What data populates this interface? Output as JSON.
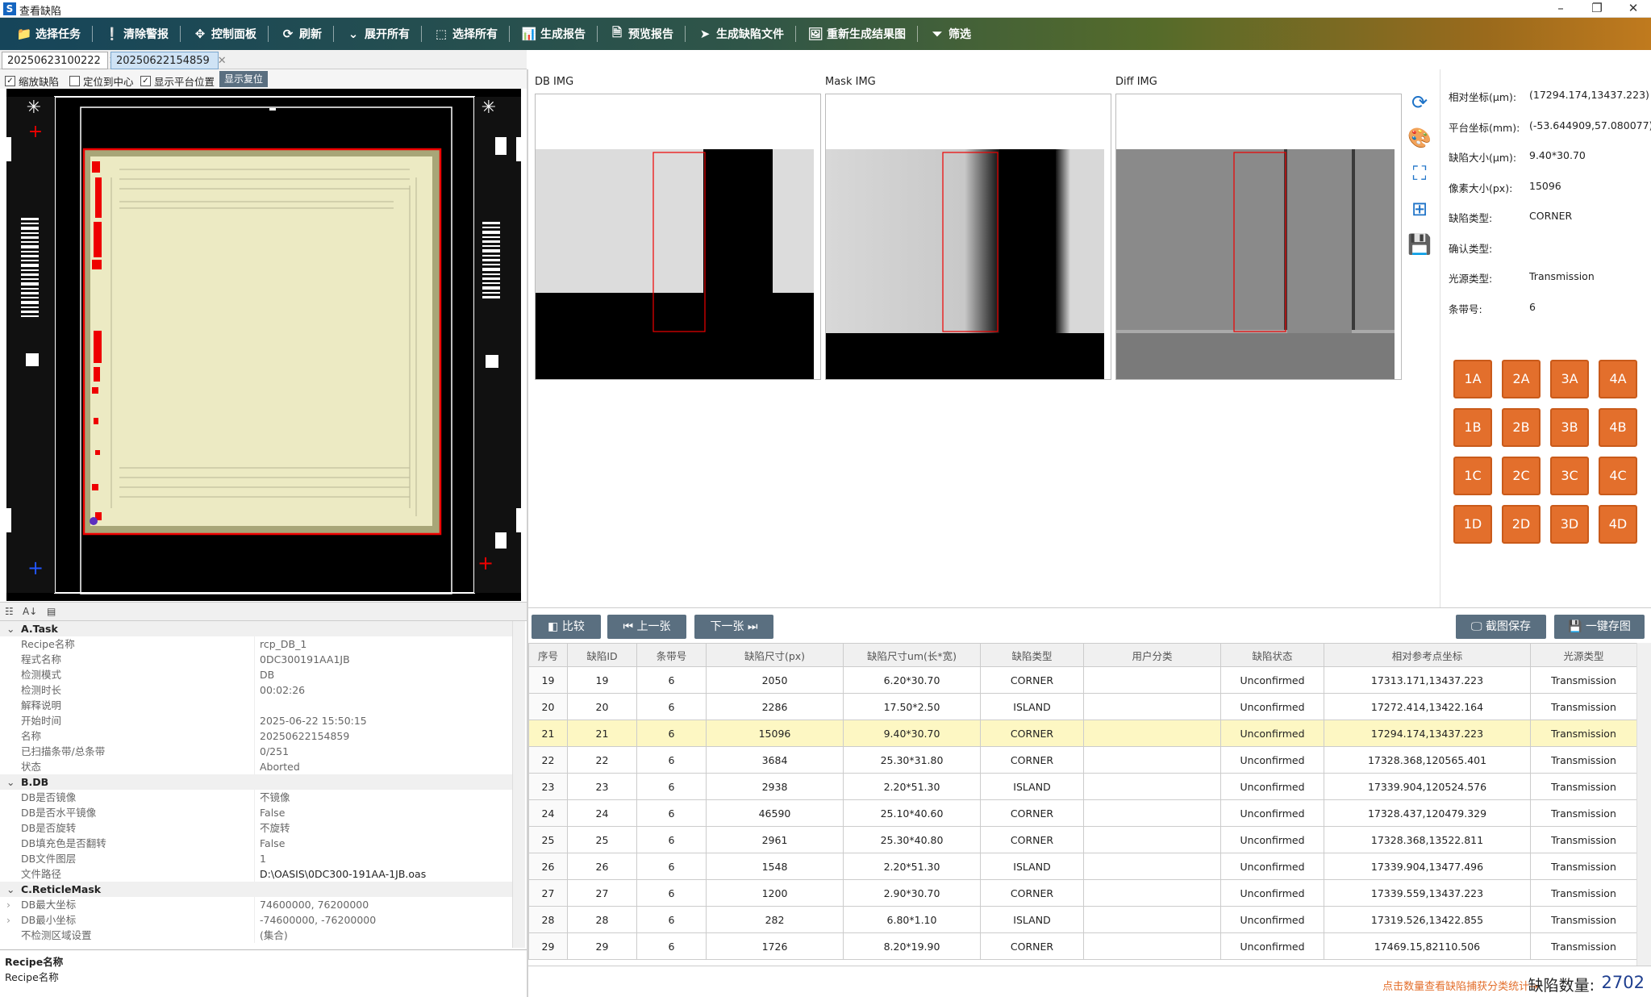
{
  "window": {
    "title": "查看缺陷",
    "app_icon": "S"
  },
  "toolbar": {
    "items": [
      {
        "label": "选择任务",
        "icon": "folder-icon"
      },
      {
        "label": "清除警报",
        "icon": "alert-icon"
      },
      {
        "label": "控制面板",
        "icon": "move-icon"
      },
      {
        "label": "刷新",
        "icon": "refresh-icon"
      },
      {
        "label": "展开所有",
        "icon": "chevron-down-icon"
      },
      {
        "label": "选择所有",
        "icon": "select-all-icon"
      },
      {
        "label": "生成报告",
        "icon": "report-icon"
      },
      {
        "label": "预览报告",
        "icon": "pdf-icon"
      },
      {
        "label": "生成缺陷文件",
        "icon": "send-icon"
      },
      {
        "label": "重新生成结果图",
        "icon": "image-refresh-icon"
      },
      {
        "label": "筛选",
        "icon": "filter-icon"
      }
    ]
  },
  "tabs": [
    {
      "label": "20250623100222",
      "active": false
    },
    {
      "label": "20250622154859",
      "active": true
    }
  ],
  "options": {
    "zoom_defect": {
      "label": "缩放缺陷",
      "checked": true
    },
    "center": {
      "label": "定位到中心",
      "checked": false
    },
    "platform_pos": {
      "label": "显示平台位置",
      "checked": true
    },
    "reset": "显示复位"
  },
  "props": {
    "categories": [
      {
        "name": "A.Task",
        "rows": [
          {
            "k": "Recipe名称",
            "v": "rcp_DB_1"
          },
          {
            "k": "程式名称",
            "v": "0DC300191AA1JB"
          },
          {
            "k": "检测模式",
            "v": "DB"
          },
          {
            "k": "检测时长",
            "v": "00:02:26"
          },
          {
            "k": "解释说明",
            "v": ""
          },
          {
            "k": "开始时间",
            "v": "2025-06-22 15:50:15"
          },
          {
            "k": "名称",
            "v": "20250622154859"
          },
          {
            "k": "已扫描条带/总条带",
            "v": "0/251"
          },
          {
            "k": "状态",
            "v": "Aborted"
          }
        ]
      },
      {
        "name": "B.DB",
        "rows": [
          {
            "k": "DB是否镜像",
            "v": "不镜像"
          },
          {
            "k": "DB是否水平镜像",
            "v": "False"
          },
          {
            "k": "DB是否旋转",
            "v": "不旋转"
          },
          {
            "k": "DB填充色是否翻转",
            "v": "False"
          },
          {
            "k": "DB文件图层",
            "v": "1"
          },
          {
            "k": "文件路径",
            "v": "D:\\OASIS\\0DC300-191AA-1JB.oas"
          }
        ]
      },
      {
        "name": "C.ReticleMask",
        "rows": [
          {
            "k": "DB最大坐标",
            "v": "74600000, 76200000",
            "expand": true
          },
          {
            "k": "DB最小坐标",
            "v": "-74600000, -76200000",
            "expand": true
          },
          {
            "k": "不检测区域设置",
            "v": "(集合)"
          }
        ]
      }
    ],
    "desc_title": "Recipe名称",
    "desc_text": "Recipe名称"
  },
  "images": {
    "db": "DB IMG",
    "mask": "Mask IMG",
    "diff": "Diff IMG"
  },
  "info": [
    {
      "k": "相对坐标(μm):",
      "v": "(17294.174,13437.223)"
    },
    {
      "k": "平台坐标(mm):",
      "v": "(-53.644909,57.080077)"
    },
    {
      "k": "缺陷大小(μm):",
      "v": "9.40*30.70"
    },
    {
      "k": "像素大小(px):",
      "v": "15096"
    },
    {
      "k": "缺陷类型:",
      "v": "CORNER"
    },
    {
      "k": "确认类型:",
      "v": ""
    },
    {
      "k": "光源类型:",
      "v": "Transmission"
    },
    {
      "k": "条带号:",
      "v": "6"
    }
  ],
  "grid_buttons": [
    "1A",
    "2A",
    "3A",
    "4A",
    "1B",
    "2B",
    "3B",
    "4B",
    "1C",
    "2C",
    "3C",
    "4C",
    "1D",
    "2D",
    "3D",
    "4D"
  ],
  "nav": {
    "compare": "比较",
    "prev": "上一张",
    "next": "下一张",
    "screenshot": "截图保存",
    "save_all": "一键存图"
  },
  "table": {
    "headers": [
      "序号",
      "缺陷ID",
      "条带号",
      "缺陷尺寸(px)",
      "缺陷尺寸um(长*宽)",
      "缺陷类型",
      "用户分类",
      "缺陷状态",
      "相对参考点坐标",
      "光源类型"
    ],
    "selected_index": 2,
    "rows": [
      [
        "19",
        "19",
        "6",
        "2050",
        "6.20*30.70",
        "CORNER",
        "",
        "Unconfirmed",
        "17313.171,13437.223",
        "Transmission"
      ],
      [
        "20",
        "20",
        "6",
        "2286",
        "17.50*2.50",
        "ISLAND",
        "",
        "Unconfirmed",
        "17272.414,13422.164",
        "Transmission"
      ],
      [
        "21",
        "21",
        "6",
        "15096",
        "9.40*30.70",
        "CORNER",
        "",
        "Unconfirmed",
        "17294.174,13437.223",
        "Transmission"
      ],
      [
        "22",
        "22",
        "6",
        "3684",
        "25.30*31.80",
        "CORNER",
        "",
        "Unconfirmed",
        "17328.368,120565.401",
        "Transmission"
      ],
      [
        "23",
        "23",
        "6",
        "2938",
        "2.20*51.30",
        "ISLAND",
        "",
        "Unconfirmed",
        "17339.904,120524.576",
        "Transmission"
      ],
      [
        "24",
        "24",
        "6",
        "46590",
        "25.10*40.60",
        "CORNER",
        "",
        "Unconfirmed",
        "17328.437,120479.329",
        "Transmission"
      ],
      [
        "25",
        "25",
        "6",
        "2961",
        "25.30*40.80",
        "CORNER",
        "",
        "Unconfirmed",
        "17328.368,13522.811",
        "Transmission"
      ],
      [
        "26",
        "26",
        "6",
        "1548",
        "2.20*51.30",
        "ISLAND",
        "",
        "Unconfirmed",
        "17339.904,13477.496",
        "Transmission"
      ],
      [
        "27",
        "27",
        "6",
        "1200",
        "2.90*30.70",
        "CORNER",
        "",
        "Unconfirmed",
        "17339.559,13437.223",
        "Transmission"
      ],
      [
        "28",
        "28",
        "6",
        "282",
        "6.80*1.10",
        "ISLAND",
        "",
        "Unconfirmed",
        "17319.526,13422.855",
        "Transmission"
      ],
      [
        "29",
        "29",
        "6",
        "1726",
        "8.20*19.90",
        "CORNER",
        "",
        "Unconfirmed",
        "17469.15,82110.506",
        "Transmission"
      ]
    ]
  },
  "status": {
    "hint": "点击数量查看缺陷捕获分类统计→",
    "label": "缺陷数量:",
    "value": "2702"
  },
  "colors": {
    "accent_orange": "#e36f2c",
    "selected_row": "#fdf7c3",
    "defect_red": "#ff0000"
  }
}
